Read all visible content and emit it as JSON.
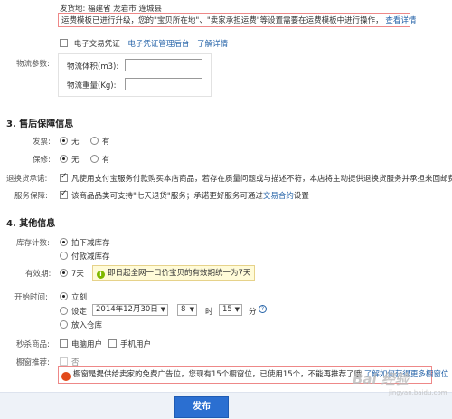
{
  "shipping": {
    "ship_from_label": "发货地:",
    "ship_from_value": "福建省 龙岩市 连城县",
    "notice_text": "运费模板已进行升级，您的\"宝贝所在地\"、\"卖家承担运费\"等设置需要在运费模板中进行操作，",
    "notice_link": "查看详情"
  },
  "invoice": {
    "label": "电子交易凭证",
    "manage_link": "电子凭证管理后台",
    "more_link": "了解详情"
  },
  "logistics": {
    "label": "物流参数:",
    "volume_label": "物流体积(m3):",
    "weight_label": "物流重量(Kg):",
    "volume_value": "",
    "weight_value": ""
  },
  "section3": {
    "title": "3. 售后保障信息",
    "invoice_label": "发票:",
    "warranty_label": "保修:",
    "no": "无",
    "yes": "有",
    "return_label": "退换货承诺:",
    "return_text": "凡使用支付宝服务付款购买本店商品，若存在质量问题或与描述不符，本店将主动提供退换货服务并承担来回邮费!",
    "guarantee_label": "服务保障:",
    "guarantee_text_pre": "该商品品类可支持\"七天退货\"服务；承诺更好服务可通过",
    "guarantee_link": "交易合约",
    "guarantee_text_post": "设置"
  },
  "section4": {
    "title": "4. 其他信息",
    "stock_label": "库存计数:",
    "stock_opt1": "拍下减库存",
    "stock_opt2": "付款减库存",
    "validity_label": "有效期:",
    "validity_opt": "7天",
    "validity_tip": "即日起全网一口价宝贝的有效期统一为7天",
    "start_label": "开始时间:",
    "start_now": "立刻",
    "start_set": "设定",
    "date_value": "2014年12月30日",
    "hour_value": "8",
    "hour_unit": "时",
    "minute_value": "15",
    "minute_unit": "分",
    "warehouse": "放入仓库",
    "flash_label": "秒杀商品:",
    "pc_user": "电脑用户",
    "mobile_user": "手机用户",
    "window_label": "橱窗推荐:",
    "window_opt": "否",
    "window_notice": "橱窗是提供给卖家的免费广告位，您现有15个橱窗位，已使用15个，不能再推荐了哦",
    "window_link": "了解如何获得更多橱窗位"
  },
  "footer": {
    "publish": "发布"
  },
  "watermark": "Bai 经验",
  "watermark_sub": "jingyan.baidu.com"
}
